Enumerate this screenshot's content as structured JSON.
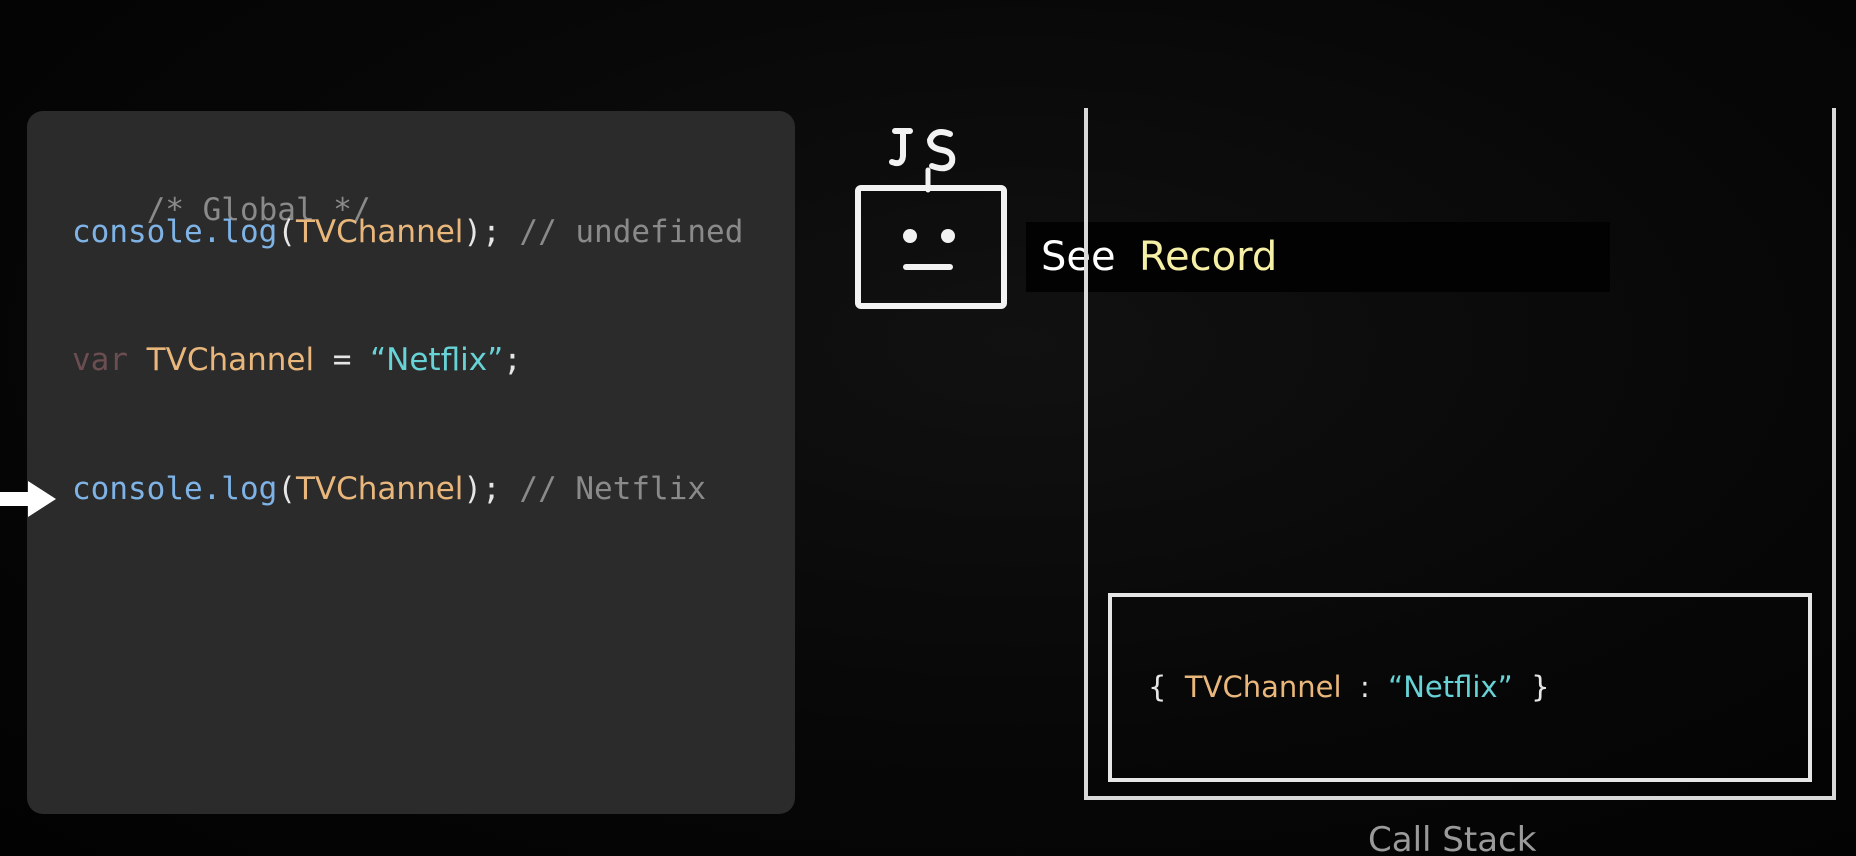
{
  "code": {
    "comment_line": "/* Global */",
    "line1": {
      "fn": "console.log",
      "open": "(",
      "arg": "TVChannel",
      "close": ");",
      "comment": "// undefined"
    },
    "line2": {
      "keyword": "var",
      "identifier": "TVChannel",
      "operator": "=",
      "value": "“Netflix”",
      "end": ";"
    },
    "line3": {
      "fn": "console.log",
      "open": "(",
      "arg": "TVChannel",
      "close": ");",
      "comment": "// Netflix"
    }
  },
  "engine": {
    "label": "JS",
    "icon": "robot-icon"
  },
  "caption": {
    "see": "See",
    "record": "Record"
  },
  "call_stack": {
    "label": "Call Stack",
    "frame": {
      "open": "{",
      "key": "TVChannel",
      "sep": ":",
      "value": "“Netflix”",
      "close": "}"
    }
  },
  "colors": {
    "panel": "#2b2b2b",
    "function": "#7fb3e6",
    "identifier": "#e9b77b",
    "string": "#67d3d6",
    "comment": "#8a8a8a",
    "record_highlight": "#f6efa6"
  }
}
